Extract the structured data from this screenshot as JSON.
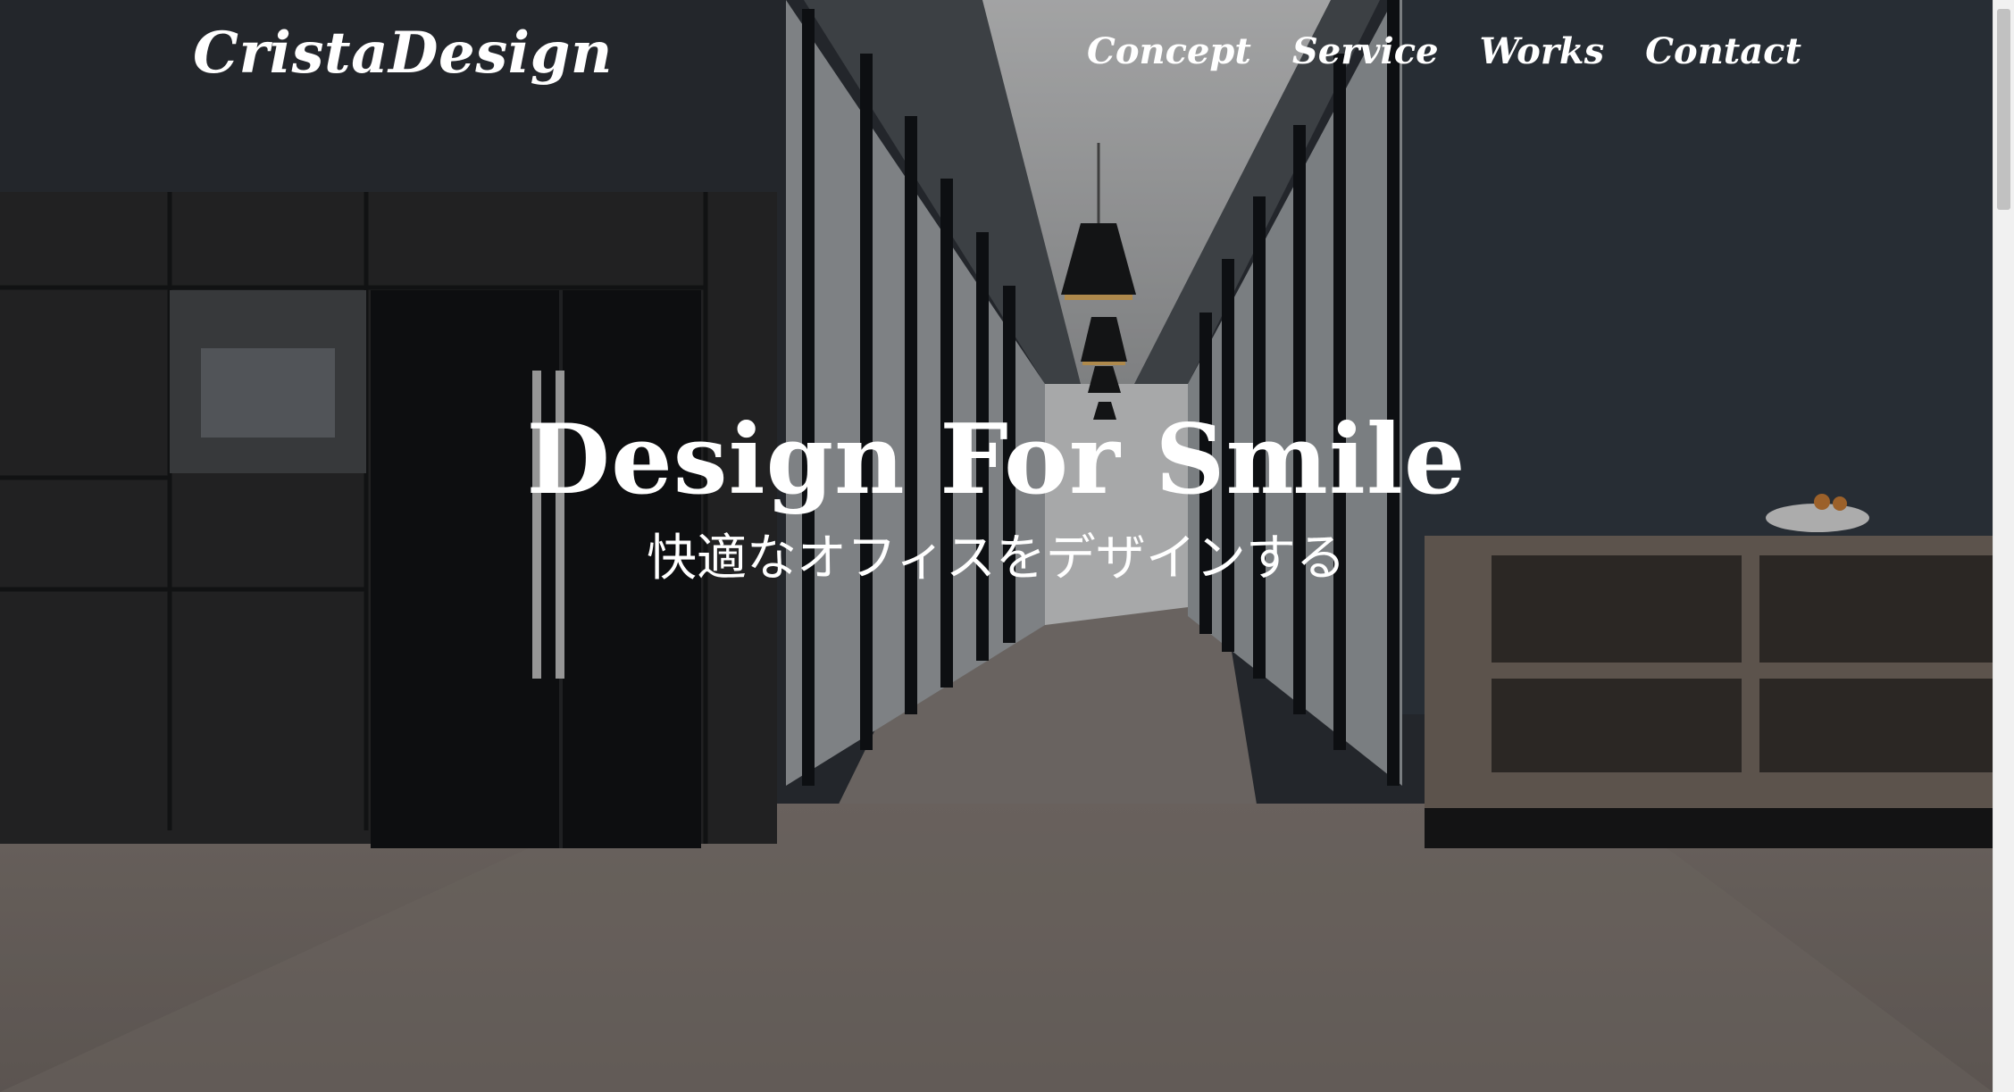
{
  "site": {
    "logo": "CristaDesign"
  },
  "nav": {
    "items": [
      {
        "label": "Concept"
      },
      {
        "label": "Service"
      },
      {
        "label": "Works"
      },
      {
        "label": "Contact"
      }
    ]
  },
  "hero": {
    "title": "Design For Smile",
    "subtitle": "快適なオフィスをデザインする",
    "background_icon": "office-hallway-photo"
  },
  "colors": {
    "text": "#ffffff",
    "wall": "#30353c",
    "floor": "#877d77",
    "overlay": "#000000",
    "scrollbar_track": "#f1f1f1",
    "scrollbar_thumb": "#c1c1c1"
  }
}
